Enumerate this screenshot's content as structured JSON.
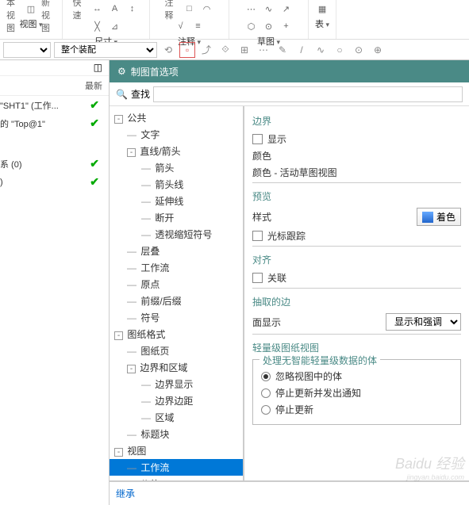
{
  "ribbon": {
    "groups": [
      {
        "label": "视图",
        "items": [
          "基本视图",
          "更新视图"
        ],
        "icons": [
          "⊞",
          "⟳",
          "◫"
        ]
      },
      {
        "label": "尺寸",
        "items": [
          "快速"
        ],
        "icons": [
          "↔",
          "A",
          "↕",
          "╳",
          "⊿",
          "⟲"
        ]
      },
      {
        "label": "注释",
        "items": [
          "注释"
        ],
        "icons": [
          "□",
          "◠",
          "√",
          "≡"
        ]
      },
      {
        "label": "草图",
        "items": [],
        "icons": [
          "⋯",
          "∿",
          "↗",
          "⬡",
          "⊙",
          "+"
        ]
      },
      {
        "label": "表",
        "items": [],
        "icons": [
          "▦"
        ]
      }
    ]
  },
  "toolbar2": {
    "dd1": "",
    "dd2": "整个装配",
    "icons": [
      "⟲",
      "⊡",
      "⤴",
      "⟐",
      "⊞",
      "⊡",
      "⋯",
      "✎",
      "/",
      "∿",
      "○",
      "□",
      "⊙",
      "⊕"
    ]
  },
  "leftPanel": {
    "iconbar": "◫",
    "header": "最新",
    "rows": [
      {
        "text": "\"SHT1\" (工作...",
        "check": true
      },
      {
        "text": "的 \"Top@1\"",
        "check": true
      },
      {
        "text": "",
        "check": false
      },
      {
        "text": "系 (0)",
        "check": true
      },
      {
        "text": ")",
        "check": true
      }
    ]
  },
  "dialog": {
    "title": "制图首选项",
    "searchLabel": "查找",
    "searchPlaceholder": "",
    "tree": [
      {
        "label": "公共",
        "level": 0,
        "toggle": "-"
      },
      {
        "label": "文字",
        "level": 1
      },
      {
        "label": "直线/箭头",
        "level": 1,
        "toggle": "-"
      },
      {
        "label": "箭头",
        "level": 2
      },
      {
        "label": "箭头线",
        "level": 2
      },
      {
        "label": "延伸线",
        "level": 2
      },
      {
        "label": "断开",
        "level": 2
      },
      {
        "label": "透视缩短符号",
        "level": 2
      },
      {
        "label": "层叠",
        "level": 1
      },
      {
        "label": "工作流",
        "level": 1
      },
      {
        "label": "原点",
        "level": 1
      },
      {
        "label": "前缀/后缀",
        "level": 1
      },
      {
        "label": "符号",
        "level": 1
      },
      {
        "label": "图纸格式",
        "level": 0,
        "toggle": "-"
      },
      {
        "label": "图纸页",
        "level": 1
      },
      {
        "label": "边界和区域",
        "level": 1,
        "toggle": "-"
      },
      {
        "label": "边界显示",
        "level": 2
      },
      {
        "label": "边界边距",
        "level": 2
      },
      {
        "label": "区域",
        "level": 2
      },
      {
        "label": "标题块",
        "level": 1
      },
      {
        "label": "视图",
        "level": 0,
        "toggle": "-"
      },
      {
        "label": "工作流",
        "level": 1,
        "selected": true
      },
      {
        "label": "公共",
        "level": 1,
        "toggle": "+"
      }
    ],
    "inheritLink": "继承",
    "props": {
      "boundary": {
        "title": "边界",
        "show": "显示",
        "colorLabel": "颜色",
        "colorValue": "颜色 - 活动草图视图"
      },
      "preview": {
        "title": "预览",
        "styleLabel": "样式",
        "styleBtn": "着色",
        "cursorTrack": "光标跟踪"
      },
      "align": {
        "title": "对齐",
        "assoc": "关联"
      },
      "extract": {
        "title": "抽取的边",
        "faceDisplayLabel": "面显示",
        "faceDisplayValue": "显示和强调"
      },
      "lightweight": {
        "title": "轻量级图纸视图",
        "groupTitle": "处理无智能轻量级数据的体",
        "opts": [
          "忽略视图中的体",
          "停止更新并发出通知",
          "停止更新"
        ]
      }
    }
  },
  "watermark": {
    "brand": "Baidu 经验",
    "url": "jingyan.baidu.com"
  }
}
